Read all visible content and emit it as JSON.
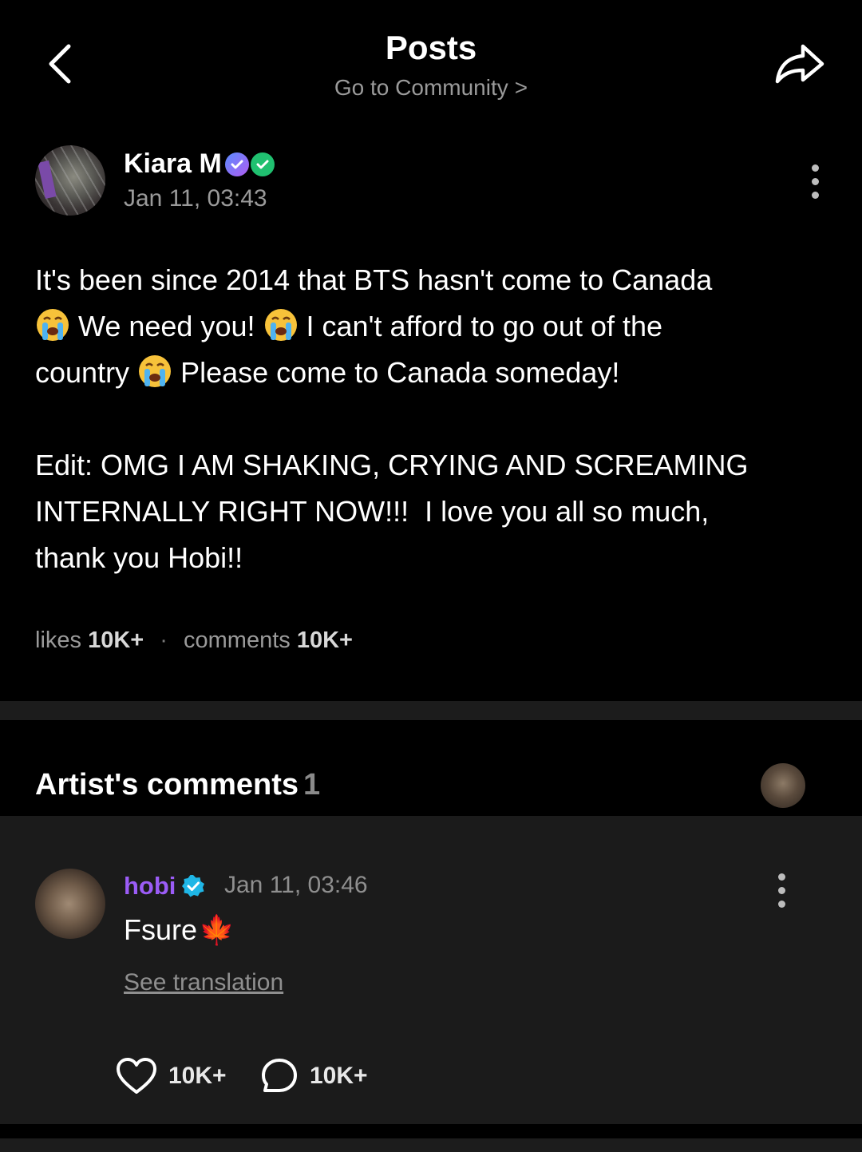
{
  "header": {
    "title": "Posts",
    "subtitle": "Go to Community",
    "subtitle_chevron": ">"
  },
  "post": {
    "author": "Kiara M",
    "date": "Jan 11, 03:43",
    "body_line1": "It's been since 2014 that BTS hasn't come to Canada",
    "body_line2_a": "We need you!",
    "body_line2_b": "I can't afford to go out of the",
    "body_line3_a": "country",
    "body_line3_b": "Please come to Canada someday!",
    "edit_line1": "Edit: OMG I AM SHAKING, CRYING AND SCREAMING",
    "edit_line2": "INTERNALLY RIGHT NOW!!!  I love you all so much,",
    "edit_line3": "thank you Hobi!!",
    "likes_label": "likes",
    "likes_count": "10K+",
    "separator": "·",
    "comments_label": "comments",
    "comments_count": "10K+"
  },
  "artist_comments": {
    "title": "Artist's comments",
    "count": "1",
    "comment": {
      "author": "hobi",
      "date": "Jan 11, 03:46",
      "text": "Fsure",
      "emoji": "🍁",
      "see_translation": "See translation",
      "like_count": "10K+",
      "reply_count": "10K+"
    }
  },
  "colors": {
    "background": "#000000",
    "artist_name": "#9b5cf6",
    "verified": "#1fb6e6",
    "muted_text": "#9a9a9a",
    "panel": "#1b1b1b"
  },
  "icons": [
    "back-arrow-icon",
    "share-icon",
    "more-vertical-icon",
    "crying-face-emoji",
    "verified-badge-icon",
    "heart-icon",
    "comment-bubble-icon",
    "maple-leaf-emoji"
  ]
}
